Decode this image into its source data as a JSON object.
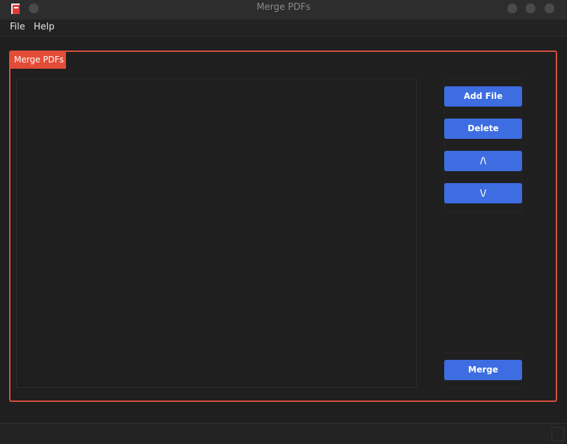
{
  "window": {
    "title": "Merge PDFs"
  },
  "menubar": {
    "items": [
      "File",
      "Help"
    ]
  },
  "group": {
    "title": "Merge PDFs"
  },
  "buttons": {
    "add_file": "Add File",
    "delete": "Delete",
    "move_up": "/\\",
    "move_down": "\\/",
    "merge": "Merge"
  },
  "colors": {
    "accent": "#3d6de0",
    "group_border": "#d9503f",
    "group_title_bg": "#e24d37",
    "background": "#1f1f1f"
  }
}
